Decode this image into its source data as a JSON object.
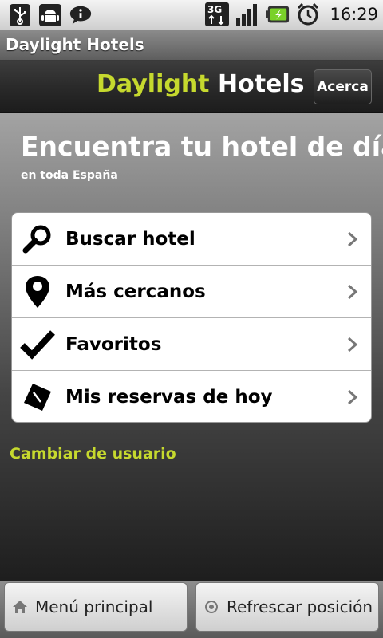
{
  "status_bar": {
    "time": "16:29",
    "left_icons": [
      "usb-icon",
      "android-debug-icon",
      "info-icon"
    ],
    "right_icons": [
      "3g-data-icon",
      "signal-icon",
      "battery-icon",
      "alarm-icon"
    ]
  },
  "app": {
    "window_title": "Daylight Hotels",
    "brand_part1": "Daylight",
    "brand_part2": "Hotels",
    "about_button": "Acerca"
  },
  "main": {
    "headline": "Encuentra tu hotel de día",
    "subline": "en toda España",
    "menu_items": [
      {
        "label": "Buscar hotel",
        "icon": "magnifier-icon"
      },
      {
        "label": "Más cercanos",
        "icon": "location-pin-icon"
      },
      {
        "label": "Favoritos",
        "icon": "checkmark-icon"
      },
      {
        "label": "Mis reservas de hoy",
        "icon": "reservation-ticket-icon"
      }
    ],
    "change_user": "Cambiar de usuario"
  },
  "bottom_bar": {
    "home_button": "Menú principal",
    "refresh_button": "Refrescar posición"
  },
  "colors": {
    "brand_accent": "#c6d92e",
    "text_white": "#ffffff"
  }
}
